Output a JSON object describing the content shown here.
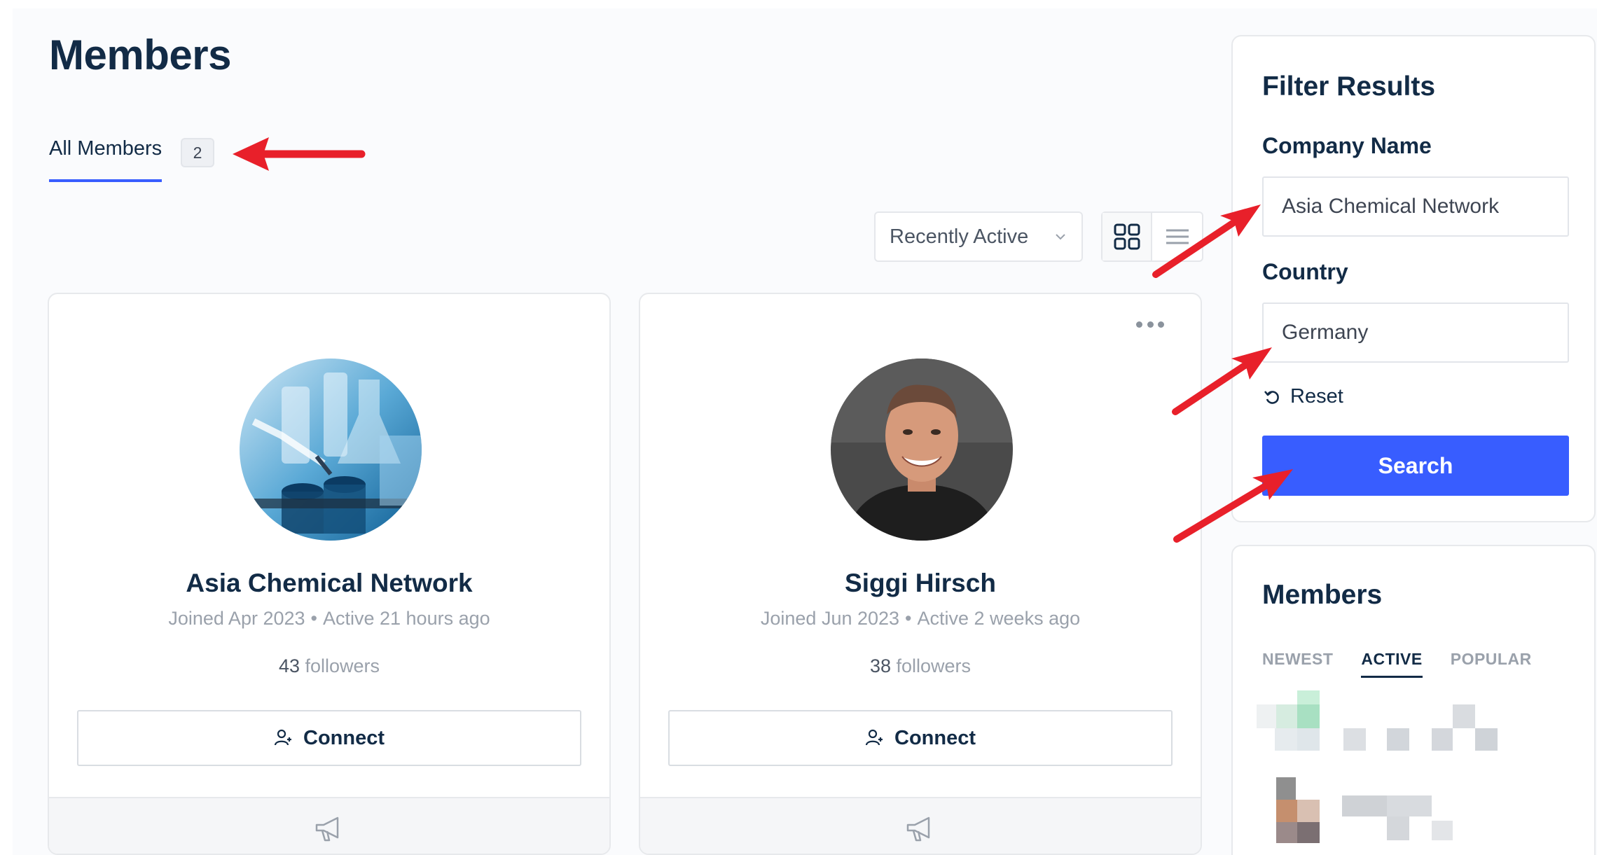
{
  "page": {
    "title": "Members"
  },
  "tabs": {
    "all_members_label": "All Members",
    "all_members_count": "2"
  },
  "toolbar": {
    "sort_selected": "Recently Active"
  },
  "members": [
    {
      "name": "Asia Chemical Network",
      "joined": "Joined Apr 2023",
      "active": "Active 21 hours ago",
      "followers_count": "43",
      "followers_label": "followers",
      "connect_label": "Connect"
    },
    {
      "name": "Siggi Hirsch",
      "joined": "Joined Jun 2023",
      "active": "Active 2 weeks ago",
      "followers_count": "38",
      "followers_label": "followers",
      "connect_label": "Connect"
    }
  ],
  "filter": {
    "title": "Filter Results",
    "company_label": "Company Name",
    "company_value": "Asia Chemical Network",
    "country_label": "Country",
    "country_value": "Germany",
    "reset_label": "Reset",
    "search_label": "Search"
  },
  "members_widget": {
    "title": "Members",
    "tabs": [
      "NEWEST",
      "ACTIVE",
      "POPULAR"
    ],
    "active_tab": "ACTIVE"
  },
  "colors": {
    "accent": "#385dff",
    "annotation_arrow": "#e8202a",
    "text_dark": "#122b46"
  }
}
